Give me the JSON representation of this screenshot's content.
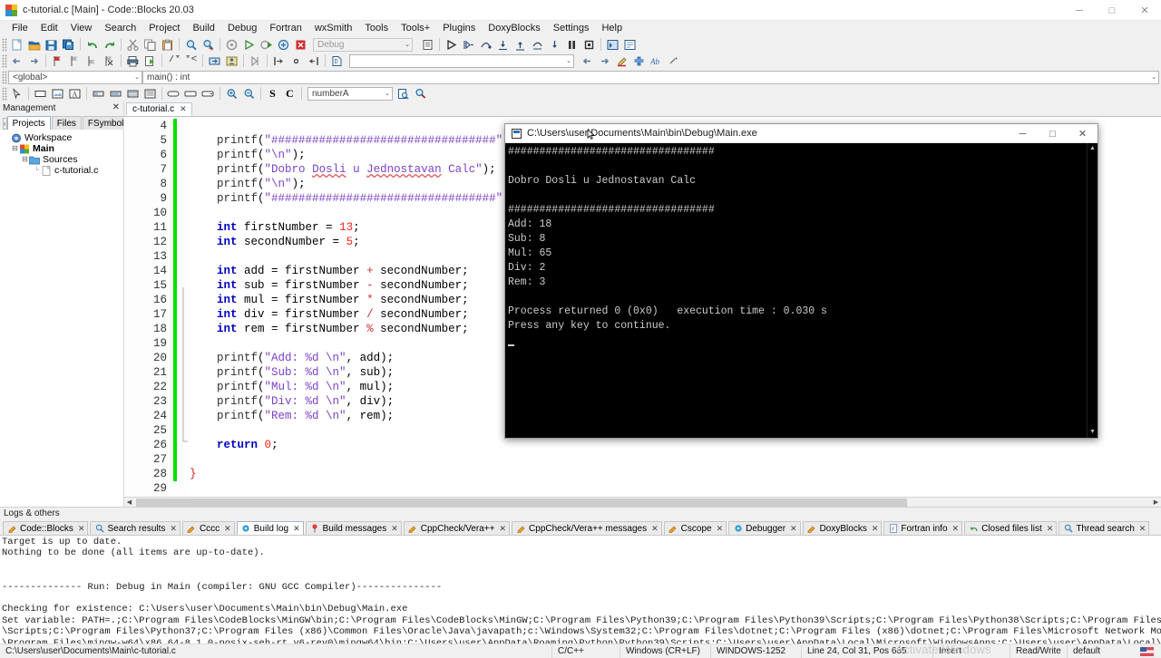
{
  "window": {
    "title": "c-tutorial.c [Main] - Code::Blocks 20.03",
    "logo_colors": [
      "#e84b2c",
      "#f5c21b",
      "#2b8fd6",
      "#5aa832"
    ],
    "minimize": "─",
    "maximize": "□",
    "close": "✕"
  },
  "menubar": {
    "items": [
      "File",
      "Edit",
      "View",
      "Search",
      "Project",
      "Build",
      "Debug",
      "Fortran",
      "wxSmith",
      "Tools",
      "Tools+",
      "Plugins",
      "DoxyBlocks",
      "Settings",
      "Help"
    ]
  },
  "toolbars": {
    "row1_icons": [
      "new-file-icon",
      "open-file-icon",
      "save-icon",
      "save-all-icon",
      "undo-icon",
      "redo-icon",
      "cut-icon",
      "copy-icon",
      "paste-icon",
      "find-icon",
      "replace-icon",
      "build-icon",
      "run-icon",
      "build-and-run-icon",
      "rebuild-icon",
      "abort-icon"
    ],
    "build_target": {
      "value": "Debug",
      "arrow": "⌄"
    },
    "row1_icons_after": [
      "build-targets-icon",
      "debug-continue-icon",
      "debug-run-to-cursor-icon",
      "debug-next-line-icon",
      "debug-step-into-icon",
      "debug-step-out-icon",
      "debug-next-instruction-icon",
      "debug-step-into-instruction-icon",
      "debug-break-icon",
      "debug-stop-icon",
      "debug-info-icon",
      "various-debug-windows-icon"
    ],
    "row2_icons": [
      "back-icon",
      "forward-icon",
      "bookmark-toggle-icon",
      "bookmark-prev-icon",
      "bookmark-next-icon",
      "bookmark-clear-icon",
      "print-icon",
      "run-script-icon",
      "comment-icon",
      "uncomment-icon",
      "goto-decl-icon",
      "goto-impl-icon",
      "code-complete-icon",
      "left-align-icon",
      "center-icon",
      "right-align-icon",
      "doxyblocks-icon"
    ],
    "row2_field": {
      "value": "",
      "placeholder": "",
      "arrow": "⌄"
    },
    "row2_icons_after": [
      "prev-icon",
      "next-icon",
      "highlight-icon",
      "extract-icon",
      "abbrev-icon",
      "more-icon"
    ],
    "scope": {
      "global_value": "<global>",
      "function_value": "main() : int",
      "arrow": "⌄"
    },
    "row4_icons": [
      "pointer-icon",
      "panel-icon",
      "image-icon",
      "text-icon",
      "toolbar-small-icon",
      "toolbar-medium-icon",
      "toolbar-large-icon",
      "list-icon",
      "button-round-icon",
      "button-wide-icon",
      "button-icon",
      "zoom-in-icon",
      "zoom-out-icon"
    ],
    "row4_letters": [
      "S",
      "C"
    ],
    "symbol_combo": {
      "value": "numberA",
      "arrow": "⌄"
    },
    "row4_icons_after": [
      "find-symbol-icon",
      "search-symbol-icon"
    ]
  },
  "management": {
    "header": "Management",
    "close": "✕",
    "tab_scroll_left": "‹",
    "tab_overflow": "▪",
    "tabs": [
      {
        "label": "Projects",
        "active": true
      },
      {
        "label": "Files",
        "active": false
      },
      {
        "label": "FSymbols",
        "active": false
      }
    ],
    "tree": [
      {
        "label": "Workspace",
        "indent": 0,
        "twisty": "",
        "icon": "workspace-icon",
        "bold": false
      },
      {
        "label": "Main",
        "indent": 1,
        "twisty": "⊟",
        "icon": "project-icon",
        "bold": true
      },
      {
        "label": "Sources",
        "indent": 2,
        "twisty": "⊟",
        "icon": "folder-icon",
        "bold": false
      },
      {
        "label": "c-tutorial.c",
        "indent": 4,
        "twisty": "",
        "icon": "c-file-icon",
        "bold": false
      }
    ]
  },
  "editor": {
    "tabs": [
      {
        "label": "c-tutorial.c",
        "close": "✕",
        "active": true
      }
    ],
    "first_line_number": 4,
    "lines": [
      {
        "n": 4,
        "text": ""
      },
      {
        "n": 5,
        "text": "    printf(\"#################################\");"
      },
      {
        "n": 6,
        "text": "    printf(\"\\n\");"
      },
      {
        "n": 7,
        "text": "    printf(\"Dobro Dosli u Jednostavan Calc\");"
      },
      {
        "n": 8,
        "text": "    printf(\"\\n\");"
      },
      {
        "n": 9,
        "text": "    printf(\"#################################\");"
      },
      {
        "n": 10,
        "text": ""
      },
      {
        "n": 11,
        "text": "    int firstNumber = 13;"
      },
      {
        "n": 12,
        "text": "    int secondNumber = 5;"
      },
      {
        "n": 13,
        "text": ""
      },
      {
        "n": 14,
        "text": "    int add = firstNumber + secondNumber;"
      },
      {
        "n": 15,
        "text": "    int sub = firstNumber - secondNumber;"
      },
      {
        "n": 16,
        "text": "    int mul = firstNumber * secondNumber;"
      },
      {
        "n": 17,
        "text": "    int div = firstNumber / secondNumber;"
      },
      {
        "n": 18,
        "text": "    int rem = firstNumber % secondNumber;"
      },
      {
        "n": 19,
        "text": ""
      },
      {
        "n": 20,
        "text": "    printf(\"Add: %d \\n\", add);"
      },
      {
        "n": 21,
        "text": "    printf(\"Sub: %d \\n\", sub);"
      },
      {
        "n": 22,
        "text": "    printf(\"Mul: %d \\n\", mul);"
      },
      {
        "n": 23,
        "text": "    printf(\"Div: %d \\n\", div);"
      },
      {
        "n": 24,
        "text": "    printf(\"Rem: %d \\n\", rem);"
      },
      {
        "n": 25,
        "text": ""
      },
      {
        "n": 26,
        "text": "    return 0;"
      },
      {
        "n": 27,
        "text": ""
      },
      {
        "n": 28,
        "text": "}"
      },
      {
        "n": 29,
        "text": ""
      }
    ],
    "hscroll_left": "◀",
    "hscroll_right": "▶"
  },
  "console": {
    "title": "C:\\Users\\user\\Documents\\Main\\bin\\Debug\\Main.exe",
    "minimize": "─",
    "maximize": "□",
    "close": "✕",
    "scroll_up": "▲",
    "scroll_down": "▼",
    "output": "#################################\n\nDobro Dosli u Jednostavan Calc\n\n#################################\nAdd: 18\nSub: 8\nMul: 65\nDiv: 2\nRem: 3\n\nProcess returned 0 (0x0)   execution time : 0.030 s\nPress any key to continue.\n"
  },
  "logs": {
    "header": "Logs & others",
    "tabs": [
      {
        "label": "Code::Blocks",
        "icon": "pencil-icon",
        "active": false
      },
      {
        "label": "Search results",
        "icon": "magnifier-icon",
        "active": false
      },
      {
        "label": "Cccc",
        "icon": "pencil-icon",
        "active": false
      },
      {
        "label": "Build log",
        "icon": "gear-icon",
        "active": true
      },
      {
        "label": "Build messages",
        "icon": "pin-icon",
        "active": false
      },
      {
        "label": "CppCheck/Vera++",
        "icon": "pencil-icon",
        "active": false
      },
      {
        "label": "CppCheck/Vera++ messages",
        "icon": "pencil-icon",
        "active": false
      },
      {
        "label": "Cscope",
        "icon": "pencil-icon",
        "active": false
      },
      {
        "label": "Debugger",
        "icon": "gear-icon",
        "active": false
      },
      {
        "label": "DoxyBlocks",
        "icon": "pencil-icon",
        "active": false
      },
      {
        "label": "Fortran info",
        "icon": "doc-icon",
        "active": false
      },
      {
        "label": "Closed files list",
        "icon": "undo-icon",
        "active": false
      },
      {
        "label": "Thread search",
        "icon": "magnifier-icon",
        "active": false
      }
    ],
    "tab_close": "✕",
    "body": "Target is up to date.\nNothing to be done (all items are up-to-date).\n\n\n-------------- Run: Debug in Main (compiler: GNU GCC Compiler)---------------\n\nChecking for existence: C:\\Users\\user\\Documents\\Main\\bin\\Debug\\Main.exe\nSet variable: PATH=.;C:\\Program Files\\CodeBlocks\\MinGW\\bin;C:\\Program Files\\CodeBlocks\\MinGW;C:\\Program Files\\Python39;C:\\Program Files\\Python39\\Scripts;C:\\Program Files\\Python38\\Scripts;C:\\Program Files\\Python38;C:\\Program Files\\Python37\n\\Scripts;C:\\Program Files\\Python37;C:\\Program Files (x86)\\Common Files\\Oracle\\Java\\javapath;c:\\Windows\\System32;C:\\Program Files\\dotnet;C:\\Program Files (x86)\\dotnet;C:\\Program Files\\Microsoft Network Monitor 3;C:\\Program Files\\Git\\cmd;C:\n\\Program Files\\mingw-w64\\x86_64-8.1.0-posix-seh-rt_v6-rev0\\mingw64\\bin;C:\\Users\\user\\AppData\\Roaming\\Python\\Python39\\Scripts;C:\\Users\\user\\AppData\\Local\\Microsoft\\WindowsApps;C:\\Users\\user\\AppData\\Local\\atom\\bin;C:\\Program Files\\heroku\n\\bin;C:\\Users\\user\\.dotnet\\tools;C:\\Program Files\\JetBrains\\PyCharm Community Edition 2020.3.4\\bin\\;\\;C:\\Python38-64;C:\\Python38-64\\Scripts\nExecuting: \"C:\\Program Files\\CodeBlocks/cb_console_runner.exe\" \"C:\\Users\\user\\Documents\\Main\\bin\\Debug\\Main.exe\"  (in C:\\Users\\user\\Documents\\Main\\.)"
  },
  "statusbar": {
    "file_path": "C:\\Users\\user\\Documents\\Main\\c-tutorial.c",
    "language": "C/C++",
    "eol": "Windows (CR+LF)",
    "encoding": "WINDOWS-1252",
    "caret": "Line 24, Col 31, Pos 665",
    "insert_mode": "Insert",
    "access": "Read/Write",
    "profile": "default",
    "keyboard_flag": "us-flag-icon"
  },
  "watermark": "Activate Windows"
}
